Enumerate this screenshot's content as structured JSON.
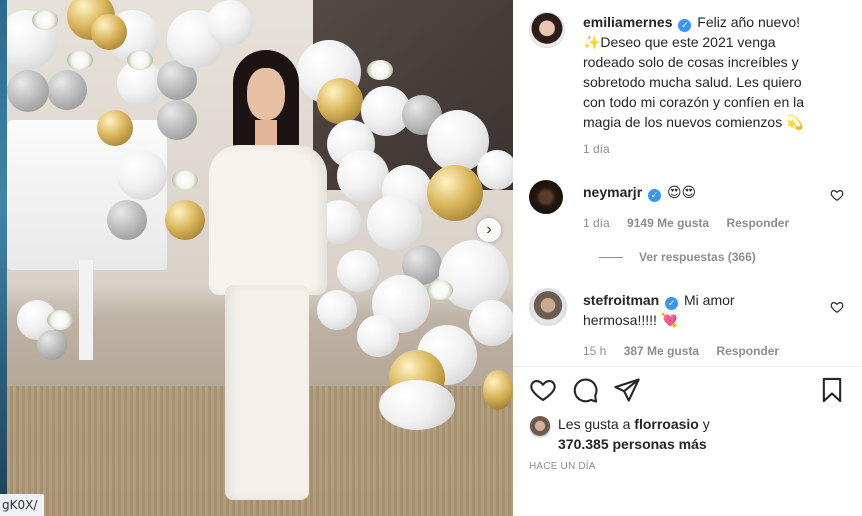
{
  "url_fragment": "gK0X/",
  "carousel": {
    "next_symbol": "›"
  },
  "post": {
    "author": "emiliamernes",
    "caption_lines": [
      "Feliz año nuevo!",
      "✨Deseo que este 2021 venga",
      "rodeado solo de cosas increíbles y",
      "sobretodo mucha salud. Les quiero",
      "con todo mi corazón y confíen en la",
      "magia de los nuevos comienzos 💫"
    ],
    "time": "1 día"
  },
  "comments": [
    {
      "username": "neymarjr",
      "text": "😍😍",
      "time": "1 día",
      "likes": "9149 Me gusta",
      "reply_label": "Responder",
      "view_replies": "Ver respuestas (366)"
    },
    {
      "username": "stefroitman",
      "text_line1": "Mi amor",
      "text_line2": "hermosa!!!!! 💘",
      "time": "15 h",
      "likes": "387 Me gusta",
      "reply_label": "Responder"
    }
  ],
  "likes": {
    "prefix": "Les gusta a",
    "user": "florroasio",
    "connector": "y",
    "count": "370.385 personas más"
  },
  "posted_ago": "HACE UN DÍA",
  "icons": {
    "verified": "verified-badge-icon",
    "like": "heart-icon",
    "comment": "comment-icon",
    "share": "paper-plane-icon",
    "save": "bookmark-icon"
  }
}
